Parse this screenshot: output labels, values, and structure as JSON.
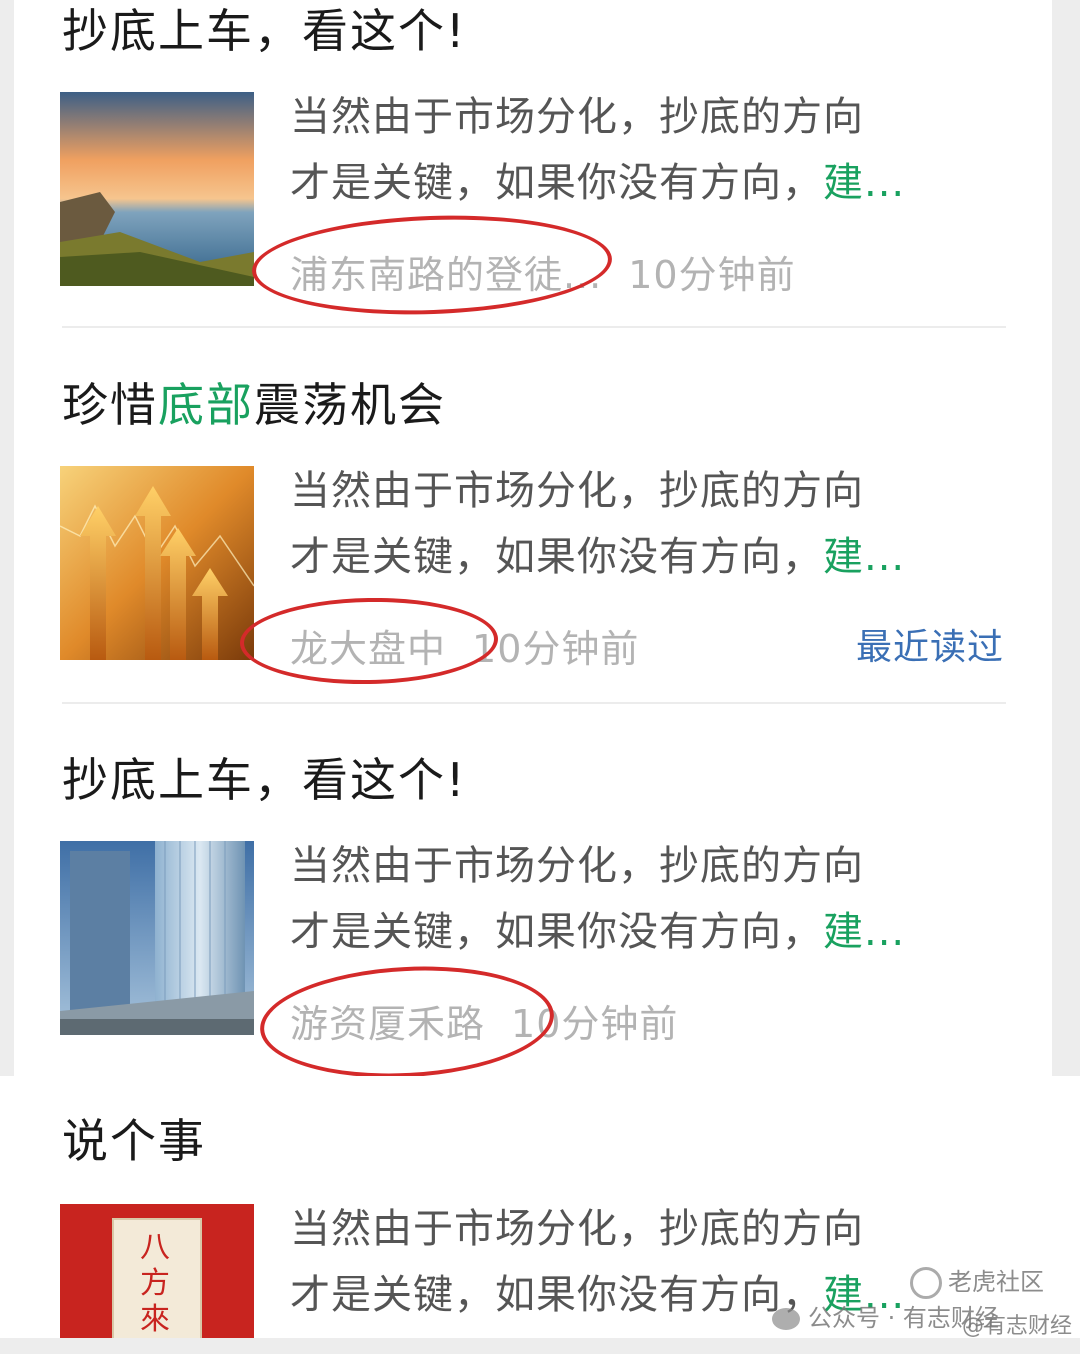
{
  "articles": [
    {
      "title_parts": [
        "抄底上车，看这个!"
      ],
      "snippet_line1": "当然由于市场分化，抄底的方向",
      "snippet_line2": "才是关键，如果你没有方向，",
      "snippet_tail": "建...",
      "author": "浦东南路的登徒...",
      "time": "10分钟前",
      "thumb": "sunset-sea"
    },
    {
      "title_pre": "珍惜",
      "title_hl": "底部",
      "title_post": "震荡机会",
      "snippet_line1": "当然由于市场分化，抄底的方向",
      "snippet_line2": "才是关键，如果你没有方向，",
      "snippet_tail": "建...",
      "author": "龙大盘中",
      "time": "10分钟前",
      "badge": "最近读过",
      "thumb": "rising-arrows"
    },
    {
      "title_parts": [
        "抄底上车，看这个!"
      ],
      "snippet_line1": "当然由于市场分化，抄底的方向",
      "snippet_line2": "才是关键，如果你没有方向，",
      "snippet_tail": "建...",
      "author": "游资厦禾路",
      "time": "10分钟前",
      "thumb": "skyscraper"
    },
    {
      "title_parts": [
        "说个事"
      ],
      "snippet_line1": "当然由于市场分化，抄底的方向",
      "snippet_line2": "才是关键，如果你没有方向，",
      "snippet_tail": "建...",
      "thumb": "red-scroll",
      "thumb_text": "八方來"
    }
  ],
  "watermarks": {
    "wechat": "公众号 · 有志财经",
    "community": "老虎社区",
    "handle": "@有志财经"
  },
  "colors": {
    "accent_green": "#19a15f",
    "annotation_red": "#d42a2a",
    "link_blue": "#3a6fb5"
  }
}
